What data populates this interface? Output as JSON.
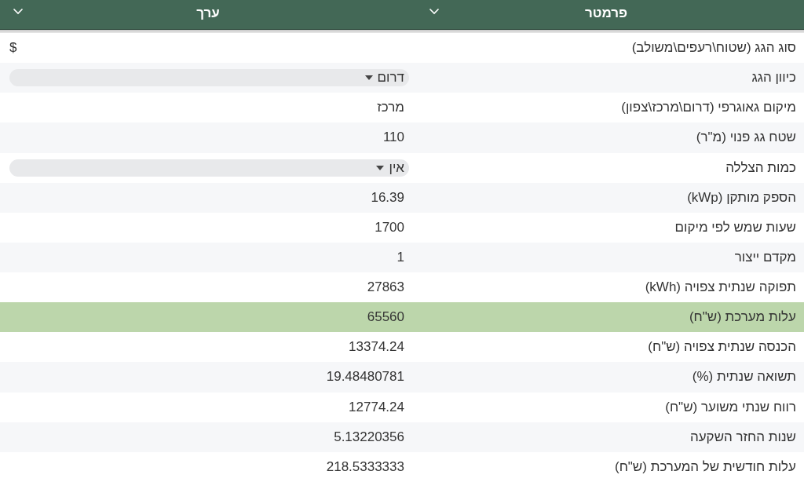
{
  "table": {
    "columns": [
      {
        "label": "פרמטר"
      },
      {
        "label": "ערך"
      }
    ],
    "rows": [
      {
        "parameter": "סוג הגג (שטוח\\רעפים\\משולב)",
        "value": "$",
        "kind": "symbol",
        "highlighted": false
      },
      {
        "parameter": "כיוון הגג",
        "value": "דרום",
        "kind": "dropdown",
        "highlighted": false
      },
      {
        "parameter": "מיקום גאוגרפי (דרום\\מרכז\\צפון)",
        "value": "מרכז",
        "kind": "text",
        "highlighted": false
      },
      {
        "parameter": "שטח גג פנוי (מ\"ר)",
        "value": "110",
        "kind": "text",
        "highlighted": false
      },
      {
        "parameter": "כמות הצללה",
        "value": "אין",
        "kind": "dropdown",
        "highlighted": false
      },
      {
        "parameter": "הספק מותקן (kWp)",
        "value": "16.39",
        "kind": "text",
        "highlighted": false
      },
      {
        "parameter": "שעות שמש לפי מיקום",
        "value": "1700",
        "kind": "text",
        "highlighted": false
      },
      {
        "parameter": "מקדם ייצור",
        "value": "1",
        "kind": "text",
        "highlighted": false
      },
      {
        "parameter": "תפוקה שנתית צפויה (kWh)",
        "value": "27863",
        "kind": "text",
        "highlighted": false
      },
      {
        "parameter": "עלות מערכת (ש\"ח)",
        "value": "65560",
        "kind": "text",
        "highlighted": true
      },
      {
        "parameter": "הכנסה שנתית צפויה (ש\"ח)",
        "value": "13374.24",
        "kind": "text",
        "highlighted": false
      },
      {
        "parameter": "תשואה שנתית (%)",
        "value": "19.48480781",
        "kind": "text",
        "highlighted": false
      },
      {
        "parameter": "רווח שנתי משוער (ש\"ח)",
        "value": "12774.24",
        "kind": "text",
        "highlighted": false
      },
      {
        "parameter": "שנות החזר השקעה",
        "value": "5.13220356",
        "kind": "text",
        "highlighted": false
      },
      {
        "parameter": "עלות חודשית של המערכת (ש\"ח)",
        "value": "218.5333333",
        "kind": "text",
        "highlighted": false
      }
    ]
  }
}
